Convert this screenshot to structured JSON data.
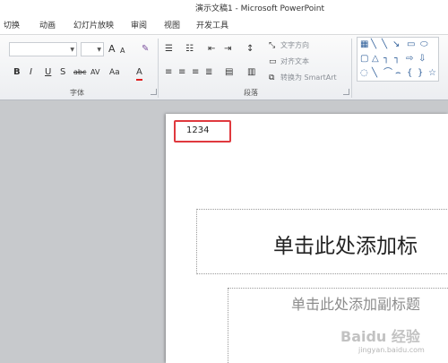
{
  "window": {
    "title": "演示文稿1 - Microsoft PowerPoint"
  },
  "ribbon_tabs": [
    "切换",
    "动画",
    "幻灯片放映",
    "审阅",
    "视图",
    "开发工具"
  ],
  "ribbon": {
    "font_group_label": "字体",
    "paragraph_group_label": "段落",
    "text_direction_label": "文字方向",
    "align_text_label": "对齐文本",
    "smartart_label": "转换为 SmartArt",
    "font_glyphs": [
      "A",
      "A",
      "B",
      "I",
      "U",
      "S",
      "abc",
      "AV",
      "Aa",
      "A"
    ]
  },
  "slide": {
    "header_text": "1234",
    "title_placeholder": "单击此处添加标",
    "subtitle_placeholder": "单击此处添加副标题"
  },
  "watermark": {
    "logo": "Baidu 经验",
    "url": "jingyan.baidu.com"
  }
}
